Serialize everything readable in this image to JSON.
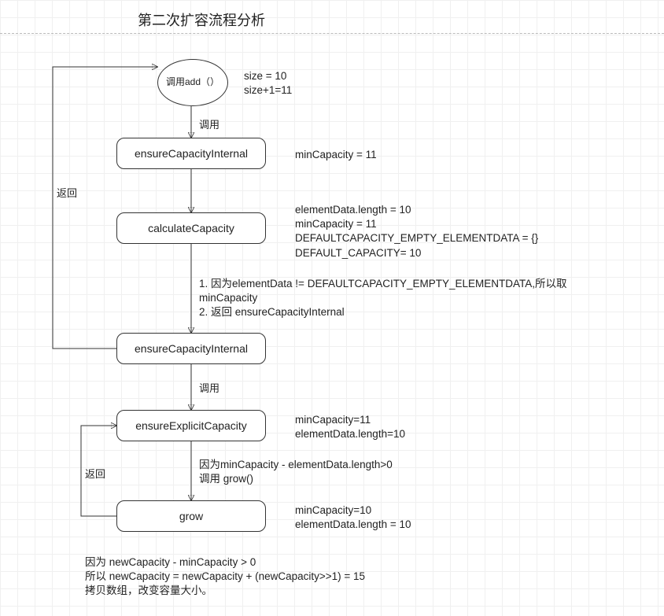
{
  "title": "第二次扩容流程分析",
  "nodes": {
    "start": "调用add（）",
    "n1": "ensureCapacityInternal",
    "n2": "calculateCapacity",
    "n3": "ensureCapacityInternal",
    "n4": "ensureExplicitCapacity",
    "n5": "grow"
  },
  "edges": {
    "e_start_n1": "调用",
    "e_n3_n4": "调用",
    "e_ret1": "返回",
    "e_ret2": "返回"
  },
  "annotations": {
    "a_start": "size = 10\nsize+1=11",
    "a_n1": "minCapacity = 11",
    "a_n2": "elementData.length = 10\nminCapacity = 11\nDEFAULTCAPACITY_EMPTY_ELEMENTDATA = {}\nDEFAULT_CAPACITY= 10",
    "a_edge_n2_n3": "1. 因为elementData != DEFAULTCAPACITY_EMPTY_ELEMENTDATA,所以取\nminCapacity\n2. 返回 ensureCapacityInternal",
    "a_n4": "minCapacity=11\nelementData.length=10",
    "a_edge_n4_n5": "因为minCapacity - elementData.length>0\n调用 grow()",
    "a_n5": "minCapacity=10\nelementData.length = 10",
    "a_bottom": "因为 newCapacity - minCapacity > 0\n所以 newCapacity = newCapacity + (newCapacity>>1) = 15\n拷贝数组，改变容量大小。"
  },
  "chart_data": {
    "type": "flowchart",
    "title": "第二次扩容流程分析",
    "nodes": [
      {
        "id": "start",
        "shape": "ellipse",
        "label": "调用add（）",
        "annotation": "size = 10\nsize+1=11"
      },
      {
        "id": "n1",
        "shape": "rect",
        "label": "ensureCapacityInternal",
        "annotation": "minCapacity = 11"
      },
      {
        "id": "n2",
        "shape": "rect",
        "label": "calculateCapacity",
        "annotation": "elementData.length = 10\nminCapacity = 11\nDEFAULTCAPACITY_EMPTY_ELEMENTDATA = {}\nDEFAULT_CAPACITY= 10"
      },
      {
        "id": "n3",
        "shape": "rect",
        "label": "ensureCapacityInternal"
      },
      {
        "id": "n4",
        "shape": "rect",
        "label": "ensureExplicitCapacity",
        "annotation": "minCapacity=11\nelementData.length=10"
      },
      {
        "id": "n5",
        "shape": "rect",
        "label": "grow",
        "annotation": "minCapacity=10\nelementData.length = 10"
      }
    ],
    "edges": [
      {
        "from": "start",
        "to": "n1",
        "label": "调用"
      },
      {
        "from": "n1",
        "to": "n2"
      },
      {
        "from": "n2",
        "to": "n3",
        "label": "1. 因为elementData != DEFAULTCAPACITY_EMPTY_ELEMENTDATA,所以取 minCapacity\n2. 返回 ensureCapacityInternal"
      },
      {
        "from": "n3",
        "to": "n4",
        "label": "调用"
      },
      {
        "from": "n4",
        "to": "n5",
        "label": "因为minCapacity - elementData.length>0\n调用 grow()"
      },
      {
        "from": "n3",
        "to": "start",
        "label": "返回",
        "kind": "return-left"
      },
      {
        "from": "n5",
        "to": "n4",
        "label": "返回",
        "kind": "return-left"
      }
    ],
    "final_annotation": "因为 newCapacity - minCapacity > 0\n所以 newCapacity = newCapacity + (newCapacity>>1) = 15\n拷贝数组，改变容量大小。"
  }
}
